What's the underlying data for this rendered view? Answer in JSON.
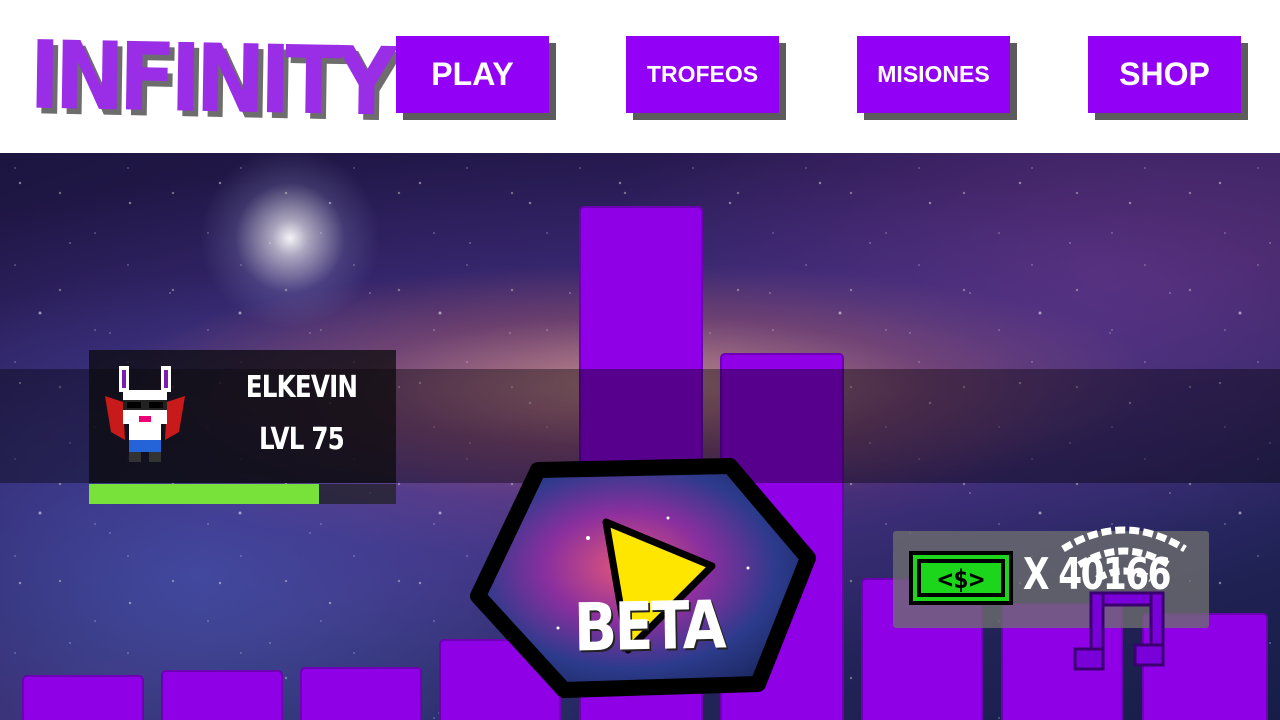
{
  "header": {
    "logo_text": "INFINITY",
    "nav": {
      "play": "PLAY",
      "trofeos": "TROFEOS",
      "misiones": "MISIONES",
      "shop": "SHOP"
    }
  },
  "player": {
    "name": "ELKEVIN",
    "level": "LVL 75",
    "xp_fraction": 0.75,
    "avatar_icon": "bunny-avatar-icon"
  },
  "play_button": {
    "icon": "play-triangle-icon"
  },
  "currency": {
    "icon": "money-bill-icon",
    "amount": "X 40166"
  },
  "beta_label": "BETA",
  "music": {
    "icon": "music-wifi-icon"
  },
  "colors": {
    "accent_purple": "#9200f5",
    "xp_green": "#79e23a",
    "play_yellow": "#ffe600",
    "bill_green": "#1bd61b"
  }
}
